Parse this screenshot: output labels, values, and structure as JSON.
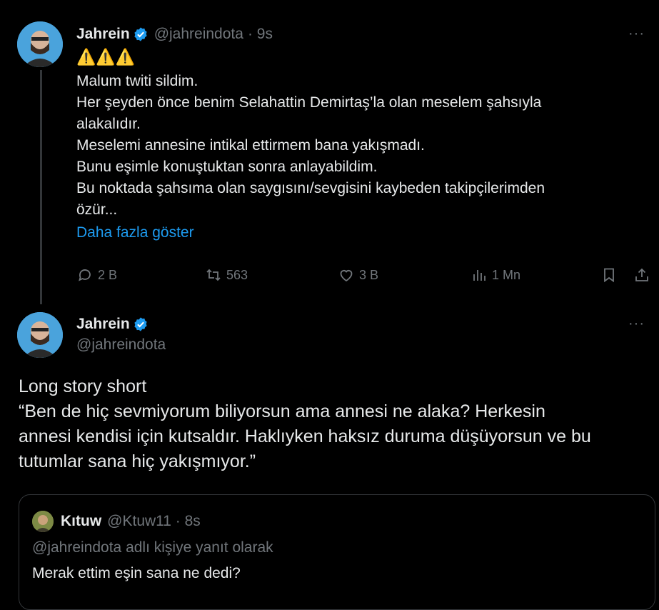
{
  "tweet1": {
    "name": "Jahrein",
    "handle": "@jahreindota",
    "time": "· 9s",
    "more": "···",
    "warning": "⚠️⚠️⚠️",
    "lines": [
      "Malum twiti sildim.",
      "Her şeyden önce benim Selahattin Demirtaş’la olan meselem şahsıyla",
      "alakalıdır.",
      "Meselemi annesine intikal ettirmem bana yakışmadı.",
      "Bunu eşimle konuştuktan sonra anlayabildim.",
      "Bu noktada şahsıma olan saygısını/sevgisini kaybeden takipçilerimden",
      "özür..."
    ],
    "show_more": "Daha fazla göster",
    "replies": "2 B",
    "retweets": "563",
    "likes": "3 B",
    "views": "1 Mn"
  },
  "tweet2": {
    "name": "Jahrein",
    "handle": "@jahreindota",
    "more": "···",
    "lines": [
      "Long story short",
      "“Ben de hiç sevmiyorum biliyorsun ama annesi ne alaka? Herkesin",
      "annesi kendisi için kutsaldır. Haklıyken haksız duruma düşüyorsun ve bu",
      "tutumlar sana hiç yakışmıyor.”"
    ]
  },
  "quote": {
    "name": "Kıtuw",
    "handle": "@Ktuw11 · 8s",
    "reply_to": "@jahreindota adlı kişiye yanıt olarak",
    "text": "Merak ettim eşin sana ne dedi?"
  },
  "colors": {
    "background": "#000000",
    "text": "#e7e9ea",
    "muted": "#71767b",
    "accent": "#1d9bf0",
    "verified": "#1d9bf0"
  },
  "icons": [
    "verified-icon",
    "more-icon",
    "reply-icon",
    "retweet-icon",
    "like-icon",
    "views-icon",
    "bookmark-icon",
    "share-icon"
  ]
}
